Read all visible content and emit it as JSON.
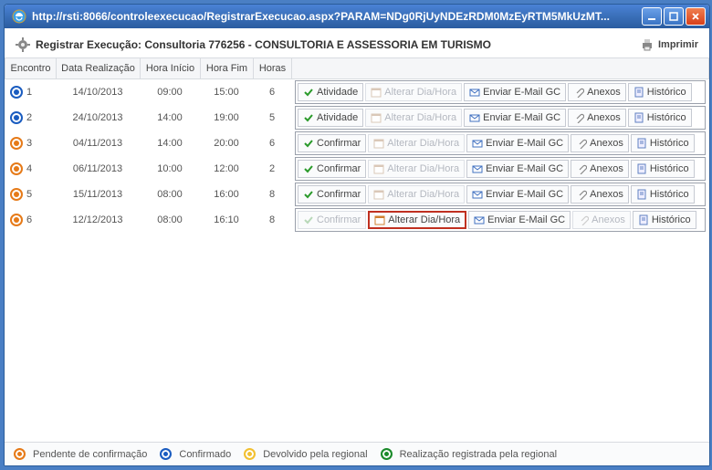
{
  "window": {
    "url": "http://rsti:8066/controleexecucao/RegistrarExecucao.aspx?PARAM=NDg0RjUyNDEzRDM0MzEyRTM5MkUzMT..."
  },
  "header": {
    "title": "Registrar Execução: Consultoria 776256 - CONSULTORIA E ASSESSORIA EM TURISMO",
    "print": "Imprimir"
  },
  "columns": {
    "encontro": "Encontro",
    "data": "Data Realização",
    "hora_inicio": "Hora Início",
    "hora_fim": "Hora Fim",
    "horas": "Horas"
  },
  "actions": {
    "atividade": "Atividade",
    "confirmar": "Confirmar",
    "alterar": "Alterar Dia/Hora",
    "enviar": "Enviar E-Mail GC",
    "anexos": "Anexos",
    "historico": "Histórico"
  },
  "rows": [
    {
      "n": "1",
      "status": "blue",
      "data": "14/10/2013",
      "hi": "09:00",
      "hf": "15:00",
      "hr": "6",
      "first": "atividade",
      "first_en": true,
      "alterar_en": false,
      "anexos_en": true,
      "alterar_high": false
    },
    {
      "n": "2",
      "status": "blue",
      "data": "24/10/2013",
      "hi": "14:00",
      "hf": "19:00",
      "hr": "5",
      "first": "atividade",
      "first_en": true,
      "alterar_en": false,
      "anexos_en": true,
      "alterar_high": false
    },
    {
      "n": "3",
      "status": "orange",
      "data": "04/11/2013",
      "hi": "14:00",
      "hf": "20:00",
      "hr": "6",
      "first": "confirmar",
      "first_en": true,
      "alterar_en": false,
      "anexos_en": true,
      "alterar_high": false
    },
    {
      "n": "4",
      "status": "orange",
      "data": "06/11/2013",
      "hi": "10:00",
      "hf": "12:00",
      "hr": "2",
      "first": "confirmar",
      "first_en": true,
      "alterar_en": false,
      "anexos_en": true,
      "alterar_high": false
    },
    {
      "n": "5",
      "status": "orange",
      "data": "15/11/2013",
      "hi": "08:00",
      "hf": "16:00",
      "hr": "8",
      "first": "confirmar",
      "first_en": true,
      "alterar_en": false,
      "anexos_en": true,
      "alterar_high": false
    },
    {
      "n": "6",
      "status": "orange",
      "data": "12/12/2013",
      "hi": "08:00",
      "hf": "16:10",
      "hr": "8",
      "first": "confirmar",
      "first_en": false,
      "alterar_en": true,
      "anexos_en": false,
      "alterar_high": true
    }
  ],
  "legend": {
    "pendente": "Pendente de confirmação",
    "confirmado": "Confirmado",
    "devolvido": "Devolvido pela regional",
    "realizacao": "Realização registrada pela regional"
  }
}
